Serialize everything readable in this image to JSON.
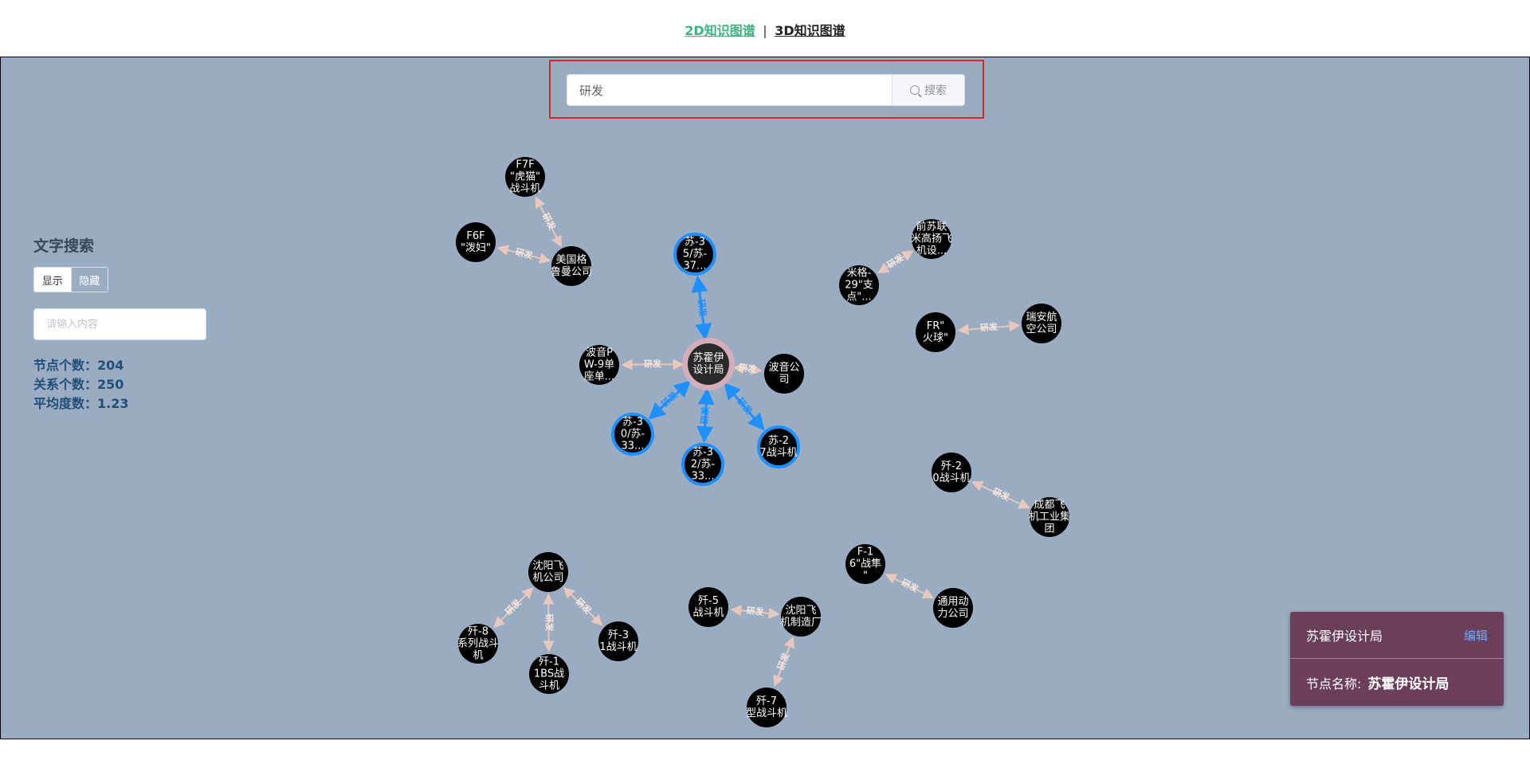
{
  "nav": {
    "link_2d": "2D知识图谱",
    "separator": "|",
    "link_3d": "3D知识图谱"
  },
  "search": {
    "value": "研发",
    "button_label": "搜索"
  },
  "panel": {
    "title": "文字搜索",
    "toggle_show": "显示",
    "toggle_hide": "隐藏",
    "input_placeholder": "请输入内容",
    "stats": [
      {
        "label": "节点个数：",
        "value": "204"
      },
      {
        "label": "关系个数：",
        "value": "250"
      },
      {
        "label": "平均度数：",
        "value": "1.23"
      }
    ]
  },
  "graph": {
    "edge_label": "研发",
    "nodes": [
      {
        "id": "n1",
        "lines": [
          "F7F",
          "\"虎猫\"",
          "战斗机"
        ]
      },
      {
        "id": "n2",
        "lines": [
          "F6F",
          "\"泼妇\""
        ]
      },
      {
        "id": "n3",
        "lines": [
          "美国格",
          "鲁曼公司"
        ]
      },
      {
        "id": "n4",
        "lines": [
          "苏-3",
          "5/苏-",
          "37..."
        ]
      },
      {
        "id": "n5",
        "lines": [
          "波音P",
          "W-9单",
          "座单..."
        ]
      },
      {
        "id": "n6",
        "lines": [
          "苏霍伊",
          "设计局"
        ]
      },
      {
        "id": "n7",
        "lines": [
          "波音公",
          "司"
        ]
      },
      {
        "id": "n8",
        "lines": [
          "苏-3",
          "0/苏-",
          "33..."
        ]
      },
      {
        "id": "n9",
        "lines": [
          "苏-3",
          "2/苏-",
          "33..."
        ]
      },
      {
        "id": "n10",
        "lines": [
          "苏-2",
          "7战斗机"
        ]
      },
      {
        "id": "n11",
        "lines": [
          "前苏联",
          "米高扬飞",
          "机设..."
        ]
      },
      {
        "id": "n12",
        "lines": [
          "米格-",
          "29\"支",
          "点\"..."
        ]
      },
      {
        "id": "n13",
        "lines": [
          "FR\"",
          "火球\""
        ]
      },
      {
        "id": "n14",
        "lines": [
          "瑞安航",
          "空公司"
        ]
      },
      {
        "id": "n15",
        "lines": [
          "歼-2",
          "0战斗机"
        ]
      },
      {
        "id": "n16",
        "lines": [
          "成都飞",
          "机工业集",
          "团"
        ]
      },
      {
        "id": "n17",
        "lines": [
          "F-1",
          "6\"战隼",
          "\""
        ]
      },
      {
        "id": "n18",
        "lines": [
          "通用动",
          "力公司"
        ]
      },
      {
        "id": "n19",
        "lines": [
          "沈阳飞",
          "机公司"
        ]
      },
      {
        "id": "n20",
        "lines": [
          "歼-8",
          "系列战斗",
          "机"
        ]
      },
      {
        "id": "n21",
        "lines": [
          "歼-1",
          "1BS战",
          "斗机"
        ]
      },
      {
        "id": "n22",
        "lines": [
          "歼-3",
          "1战斗机"
        ]
      },
      {
        "id": "n23",
        "lines": [
          "歼-5",
          "战斗机"
        ]
      },
      {
        "id": "n24",
        "lines": [
          "沈阳飞",
          "机制造厂"
        ]
      },
      {
        "id": "n25",
        "lines": [
          "歼-7",
          "型战斗机"
        ]
      }
    ],
    "edges": [
      {
        "from": "n3",
        "to": "n1",
        "color": "light"
      },
      {
        "from": "n3",
        "to": "n2",
        "color": "light"
      },
      {
        "from": "n6",
        "to": "n4",
        "color": "blue"
      },
      {
        "from": "n6",
        "to": "n5",
        "color": "light"
      },
      {
        "from": "n6",
        "to": "n7",
        "color": "light"
      },
      {
        "from": "n6",
        "to": "n8",
        "color": "blue"
      },
      {
        "from": "n6",
        "to": "n9",
        "color": "blue"
      },
      {
        "from": "n6",
        "to": "n10",
        "color": "blue"
      },
      {
        "from": "n11",
        "to": "n12",
        "color": "light"
      },
      {
        "from": "n14",
        "to": "n13",
        "color": "light"
      },
      {
        "from": "n16",
        "to": "n15",
        "color": "light"
      },
      {
        "from": "n18",
        "to": "n17",
        "color": "light"
      },
      {
        "from": "n19",
        "to": "n20",
        "color": "light"
      },
      {
        "from": "n19",
        "to": "n21",
        "color": "light"
      },
      {
        "from": "n19",
        "to": "n22",
        "color": "light"
      },
      {
        "from": "n24",
        "to": "n23",
        "color": "light"
      },
      {
        "from": "n24",
        "to": "n25",
        "color": "light"
      }
    ]
  },
  "info_card": {
    "title": "苏霍伊设计局",
    "edit_label": "编辑",
    "field_label": "节点名称:",
    "field_value": "苏霍伊设计局"
  },
  "colors": {
    "canvas_bg": "#9aacc2",
    "node_fill": "#000000",
    "highlight": "#1e90ff",
    "edge_light": "#e8c8bd",
    "card_bg": "#6b3e5a"
  }
}
